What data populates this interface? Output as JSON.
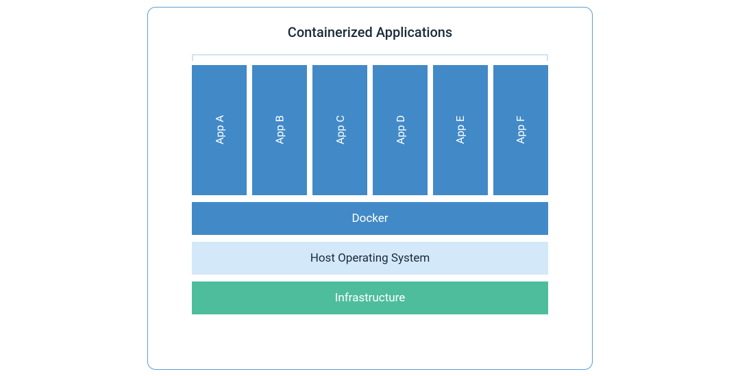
{
  "title": "Containerized Applications",
  "apps": {
    "a": "App A",
    "b": "App B",
    "c": "App C",
    "d": "App D",
    "e": "App E",
    "f": "App F"
  },
  "layers": {
    "docker": "Docker",
    "host": "Host Operating System",
    "infra": "Infrastructure"
  },
  "colors": {
    "border": "#5b9cd5",
    "app_box": "#4289c7",
    "docker_layer": "#4289c7",
    "host_layer": "#d3e8f8",
    "infra_layer": "#4ebd9c",
    "bracket": "#cfe4f5"
  }
}
